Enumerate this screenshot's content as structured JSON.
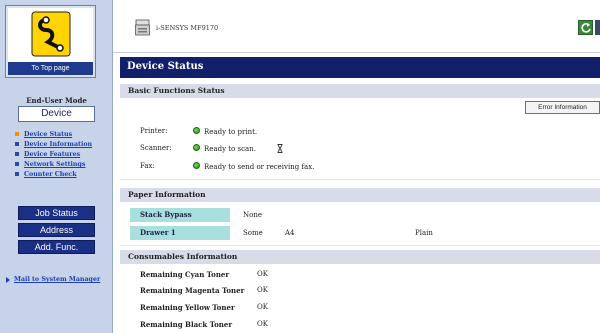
{
  "sidebar": {
    "top_page_label": "To Top page",
    "mode_label": "End-User Mode",
    "device_button": "Device",
    "nav_items": [
      {
        "label": "Device Status"
      },
      {
        "label": "Device Information"
      },
      {
        "label": "Device Features"
      },
      {
        "label": "Network Settings"
      },
      {
        "label": "Counter Check"
      }
    ],
    "buttons": {
      "job_status": "Job Status",
      "address": "Address",
      "add_func": "Add. Func."
    },
    "mail_link": "Mail to System Manager"
  },
  "header": {
    "device_name": "i-SENSYS MF9170",
    "printer_icon": "printer-icon",
    "refresh_icon": "refresh-icon"
  },
  "main": {
    "page_title": "Device Status",
    "basic_section": {
      "title": "Basic Functions Status",
      "error_button": "Error Information",
      "rows": [
        {
          "label": "Printer:",
          "message": "Ready to print."
        },
        {
          "label": "Scanner:",
          "message": "Ready to scan."
        },
        {
          "label": "Fax:",
          "message": "Ready to send or receiving fax."
        }
      ],
      "status_icon": "green-status-icon",
      "busy_icon": "hourglass-icon"
    },
    "paper_section": {
      "title": "Paper Information",
      "rows": [
        {
          "name": "Stack Bypass",
          "level": "None",
          "size": "",
          "type": ""
        },
        {
          "name": "Drawer 1",
          "level": "Some",
          "size": "A4",
          "type": "Plain"
        }
      ]
    },
    "consumables_section": {
      "title": "Consumables Information",
      "rows": [
        {
          "name": "Remaining Cyan Toner",
          "value": "OK"
        },
        {
          "name": "Remaining Magenta Toner",
          "value": "OK"
        },
        {
          "name": "Remaining Yellow Toner",
          "value": "OK"
        },
        {
          "name": "Remaining Black Toner",
          "value": "OK"
        }
      ]
    }
  },
  "colors": {
    "sidebar_bg": "#c7d3e8",
    "title_bar": "#12206b",
    "side_button": "#1a2f86",
    "section_head": "#d7dce8",
    "paper_name_cell": "#a8e0e0",
    "status_green": "#2fa52a",
    "active_bullet": "#ff8a00"
  }
}
